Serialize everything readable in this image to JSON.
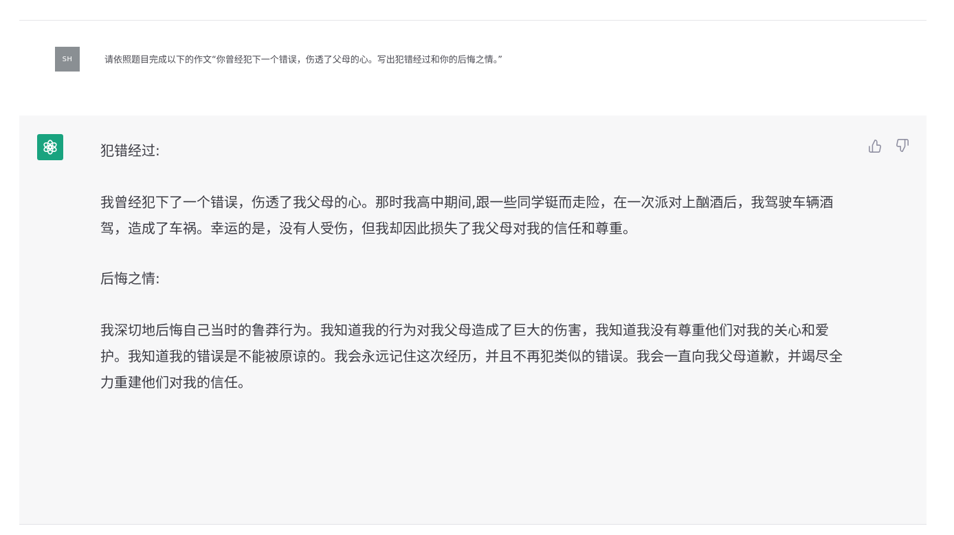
{
  "user_message": {
    "avatar_initials": "SH",
    "text": "请依照题目完成以下的作文“你曾经犯下一个错误，伤透了父母的心。写出犯错经过和你的后悔之情。”"
  },
  "assistant_message": {
    "avatar_icon": "openai-logo-icon",
    "avatar_color": "#19a37f",
    "sections": {
      "heading_1": "犯错经过:",
      "paragraph_1": "我曾经犯下了一个错误，伤透了我父母的心。那时我高中期间,跟一些同学铤而走险，在一次派对上酗酒后，我驾驶车辆酒驾，造成了车祸。幸运的是，没有人受伤，但我却因此损失了我父母对我的信任和尊重。",
      "heading_2": "后悔之情:",
      "paragraph_2": "我深切地后悔自己当时的鲁莽行为。我知道我的行为对我父母造成了巨大的伤害，我知道我没有尊重他们对我的关心和爱护。我知道我的错误是不能被原谅的。我会永远记住这次经历，并且不再犯类似的错误。我会一直向我父母道歉，并竭尽全力重建他们对我的信任。"
    },
    "feedback": {
      "thumbs_up_icon": "thumbs-up-icon",
      "thumbs_down_icon": "thumbs-down-icon"
    }
  }
}
